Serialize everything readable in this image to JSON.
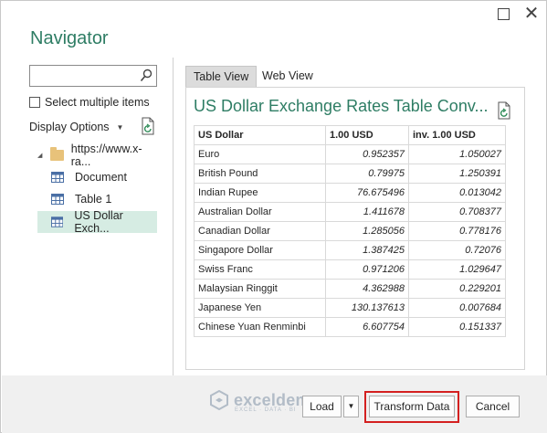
{
  "window": {
    "title": "Navigator",
    "close_glyph": "✕"
  },
  "search": {
    "value": "",
    "placeholder": ""
  },
  "select_multiple": {
    "label": "Select multiple items",
    "checked": false
  },
  "display_options": {
    "label": "Display Options"
  },
  "tree": {
    "root": {
      "label": "https://www.x-ra...",
      "expanded": true
    },
    "items": [
      {
        "label": "Document",
        "icon": "table-icon",
        "selected": false
      },
      {
        "label": "Table 1",
        "icon": "table-icon",
        "selected": false
      },
      {
        "label": "US Dollar Exch...",
        "icon": "table-icon",
        "selected": true
      }
    ]
  },
  "tabs": [
    {
      "label": "Table View",
      "active": true
    },
    {
      "label": "Web View",
      "active": false
    }
  ],
  "preview": {
    "title": "US Dollar Exchange Rates Table Conv...",
    "columns": [
      "US Dollar",
      "1.00 USD",
      "inv. 1.00 USD"
    ],
    "rows": [
      [
        "Euro",
        "0.952357",
        "1.050027"
      ],
      [
        "British Pound",
        "0.79975",
        "1.250391"
      ],
      [
        "Indian Rupee",
        "76.675496",
        "0.013042"
      ],
      [
        "Australian Dollar",
        "1.411678",
        "0.708377"
      ],
      [
        "Canadian Dollar",
        "1.285056",
        "0.778176"
      ],
      [
        "Singapore Dollar",
        "1.387425",
        "0.72076"
      ],
      [
        "Swiss Franc",
        "0.971206",
        "1.029647"
      ],
      [
        "Malaysian Ringgit",
        "4.362988",
        "0.229201"
      ],
      [
        "Japanese Yen",
        "130.137613",
        "0.007684"
      ],
      [
        "Chinese Yuan Renminbi",
        "6.607754",
        "0.151337"
      ]
    ]
  },
  "footer": {
    "load_label": "Load",
    "transform_label": "Transform Data",
    "cancel_label": "Cancel"
  },
  "watermark": {
    "name": "exceldemy",
    "tagline": "EXCEL · DATA · BI"
  },
  "colors": {
    "accent": "#2e7d64",
    "selection": "#d6ece3",
    "highlight": "#d42020"
  }
}
